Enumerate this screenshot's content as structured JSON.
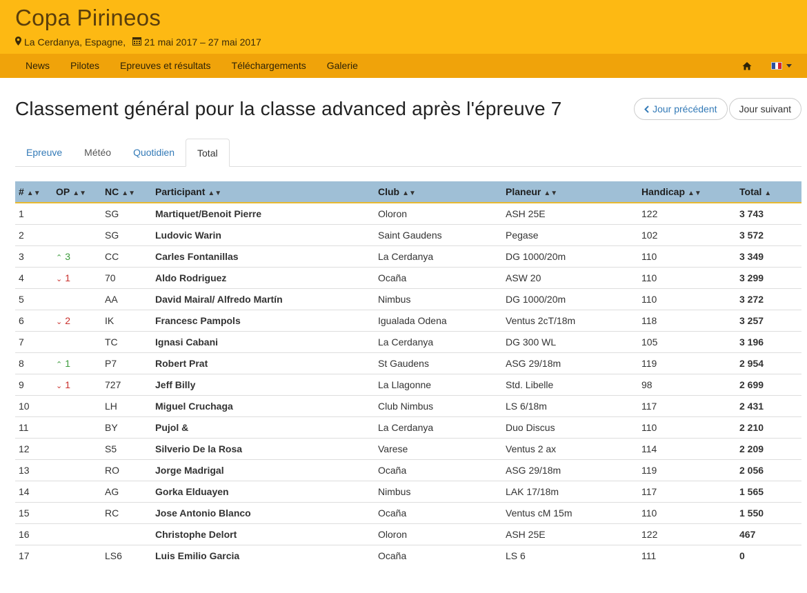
{
  "header": {
    "site_title": "Copa Pirineos",
    "location": "La Cerdanya, Espagne,",
    "dates": "21 mai 2017 – 27 mai 2017"
  },
  "nav": {
    "items": [
      "News",
      "Pilotes",
      "Epreuves et résultats",
      "Téléchargements",
      "Galerie"
    ]
  },
  "page": {
    "title": "Classement général pour la classe advanced après l'épreuve 7",
    "prev_button": "Jour précédent",
    "next_button": "Jour suivant"
  },
  "tabs": [
    {
      "label": "Epreuve"
    },
    {
      "label": "Météo"
    },
    {
      "label": "Quotidien"
    },
    {
      "label": "Total"
    }
  ],
  "table": {
    "headers": [
      "#",
      "OP",
      "NC",
      "Participant",
      "Club",
      "Planeur",
      "Handicap",
      "Total"
    ],
    "rows": [
      {
        "rank": "1",
        "op_dir": "",
        "op": "",
        "nc": "SG",
        "participant": "Martiquet/Benoit Pierre",
        "club": "Oloron",
        "glider": "ASH 25E",
        "handicap": "122",
        "total": "3 743"
      },
      {
        "rank": "2",
        "op_dir": "",
        "op": "",
        "nc": "SG",
        "participant": "Ludovic Warin",
        "club": "Saint Gaudens",
        "glider": "Pegase",
        "handicap": "102",
        "total": "3 572"
      },
      {
        "rank": "3",
        "op_dir": "up",
        "op": "3",
        "nc": "CC",
        "participant": "Carles Fontanillas",
        "club": "La Cerdanya",
        "glider": "DG 1000/20m",
        "handicap": "110",
        "total": "3 349"
      },
      {
        "rank": "4",
        "op_dir": "down",
        "op": "1",
        "nc": "70",
        "participant": "Aldo Rodriguez",
        "club": "Ocaña",
        "glider": "ASW 20",
        "handicap": "110",
        "total": "3 299"
      },
      {
        "rank": "5",
        "op_dir": "",
        "op": "",
        "nc": "AA",
        "participant": "David Mairal/ Alfredo Martín",
        "club": "Nimbus",
        "glider": "DG 1000/20m",
        "handicap": "110",
        "total": "3 272"
      },
      {
        "rank": "6",
        "op_dir": "down",
        "op": "2",
        "nc": "IK",
        "participant": "Francesc Pampols",
        "club": "Igualada Odena",
        "glider": "Ventus 2cT/18m",
        "handicap": "118",
        "total": "3 257"
      },
      {
        "rank": "7",
        "op_dir": "",
        "op": "",
        "nc": "TC",
        "participant": "Ignasi Cabani",
        "club": "La Cerdanya",
        "glider": "DG 300 WL",
        "handicap": "105",
        "total": "3 196"
      },
      {
        "rank": "8",
        "op_dir": "up",
        "op": "1",
        "nc": "P7",
        "participant": "Robert Prat",
        "club": "St Gaudens",
        "glider": "ASG 29/18m",
        "handicap": "119",
        "total": "2 954"
      },
      {
        "rank": "9",
        "op_dir": "down",
        "op": "1",
        "nc": "727",
        "participant": "Jeff Billy",
        "club": "La Llagonne",
        "glider": "Std. Libelle",
        "handicap": "98",
        "total": "2 699"
      },
      {
        "rank": "10",
        "op_dir": "",
        "op": "",
        "nc": "LH",
        "participant": "Miguel Cruchaga",
        "club": "Club Nimbus",
        "glider": "LS 6/18m",
        "handicap": "117",
        "total": "2 431"
      },
      {
        "rank": "11",
        "op_dir": "",
        "op": "",
        "nc": "BY",
        "participant": "Pujol &",
        "club": "La Cerdanya",
        "glider": "Duo Discus",
        "handicap": "110",
        "total": "2 210"
      },
      {
        "rank": "12",
        "op_dir": "",
        "op": "",
        "nc": "S5",
        "participant": "Silverio De la Rosa",
        "club": "Varese",
        "glider": "Ventus 2 ax",
        "handicap": "114",
        "total": "2 209"
      },
      {
        "rank": "13",
        "op_dir": "",
        "op": "",
        "nc": "RO",
        "participant": "Jorge Madrigal",
        "club": "Ocaña",
        "glider": "ASG 29/18m",
        "handicap": "119",
        "total": "2 056"
      },
      {
        "rank": "14",
        "op_dir": "",
        "op": "",
        "nc": "AG",
        "participant": "Gorka Elduayen",
        "club": "Nimbus",
        "glider": "LAK 17/18m",
        "handicap": "117",
        "total": "1 565"
      },
      {
        "rank": "15",
        "op_dir": "",
        "op": "",
        "nc": "RC",
        "participant": "Jose Antonio Blanco",
        "club": "Ocaña",
        "glider": "Ventus cM 15m",
        "handicap": "110",
        "total": "1 550"
      },
      {
        "rank": "16",
        "op_dir": "",
        "op": "",
        "nc": "",
        "participant": "Christophe Delort",
        "club": "Oloron",
        "glider": "ASH 25E",
        "handicap": "122",
        "total": "467"
      },
      {
        "rank": "17",
        "op_dir": "",
        "op": "",
        "nc": "LS6",
        "participant": "Luis Emilio Garcia",
        "club": "Ocaña",
        "glider": "LS 6",
        "handicap": "111",
        "total": "0"
      }
    ]
  }
}
